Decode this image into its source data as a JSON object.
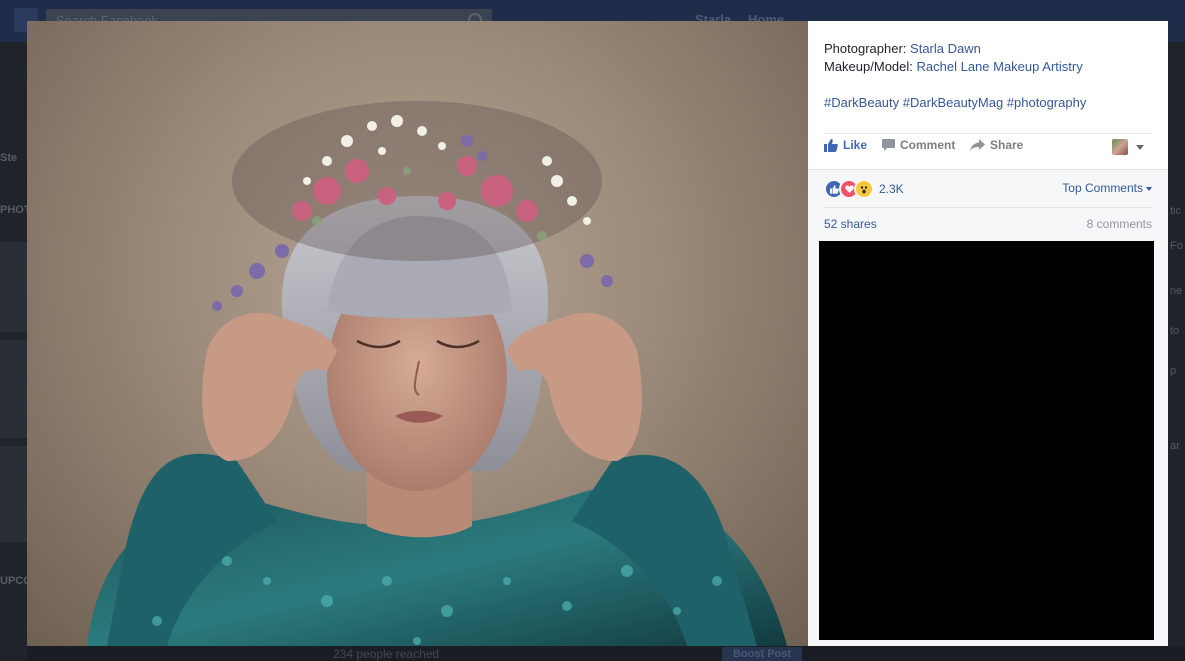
{
  "background_page": {
    "search_placeholder": "Search Facebook",
    "nav": [
      "Starla",
      "Home"
    ],
    "left_labels": [
      "Ste",
      "PHOT",
      "UPCO"
    ],
    "right_labels": [
      "tic",
      "Fo",
      "ne",
      "to",
      "p",
      "ar"
    ],
    "reach_text": "234 people reached",
    "boost_label": "Boost Post"
  },
  "post": {
    "credits": {
      "photographer_label": "Photographer:",
      "photographer_name": "Starla Dawn",
      "makeup_label": "Makeup/Model:",
      "makeup_name": "Rachel Lane Makeup Artistry"
    },
    "hashtags": "#DarkBeauty #DarkBeautyMag #photography",
    "actions": {
      "like": "Like",
      "comment": "Comment",
      "share": "Share"
    },
    "reactions": {
      "types": [
        "like-icon",
        "love-icon",
        "wow-icon"
      ],
      "count": "2.3K"
    },
    "top_comments_label": "Top Comments",
    "shares_count": "52 shares",
    "comments_count": "8 comments"
  },
  "colors": {
    "link": "#365899",
    "like_blue": "#4267b2",
    "love_red": "#f25268",
    "wow_yellow": "#fcc83a",
    "overlay_dark": "#1d2129"
  }
}
